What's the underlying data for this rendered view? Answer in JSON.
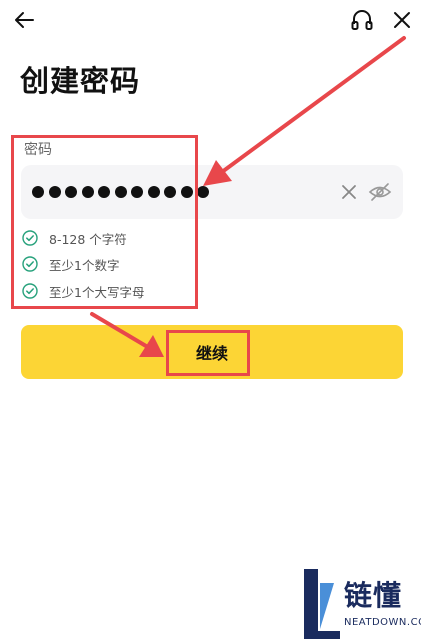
{
  "header": {
    "back_icon": "arrow-left-icon",
    "support_icon": "headset-icon",
    "close_icon": "close-icon"
  },
  "page": {
    "title": "创建密码"
  },
  "password_field": {
    "label": "密码",
    "masked_length": 11,
    "clear_icon": "clear-x-icon",
    "visibility_icon": "eye-off-icon"
  },
  "rules": [
    {
      "text": "8-128 个字符",
      "status": "met",
      "icon": "check-circle-icon"
    },
    {
      "text": "至少1个数字",
      "status": "met",
      "icon": "check-circle-icon"
    },
    {
      "text": "至少1个大写字母",
      "status": "met",
      "icon": "check-circle-icon"
    }
  ],
  "continue_button": {
    "label": "继续"
  },
  "watermark": {
    "brand": "链懂",
    "url": "NEATDOWN.COM"
  },
  "colors": {
    "accent_yellow": "#fcd535",
    "check_green": "#26a17b",
    "annotation_red": "#e8474b",
    "watermark_navy": "#1a2b5e"
  }
}
